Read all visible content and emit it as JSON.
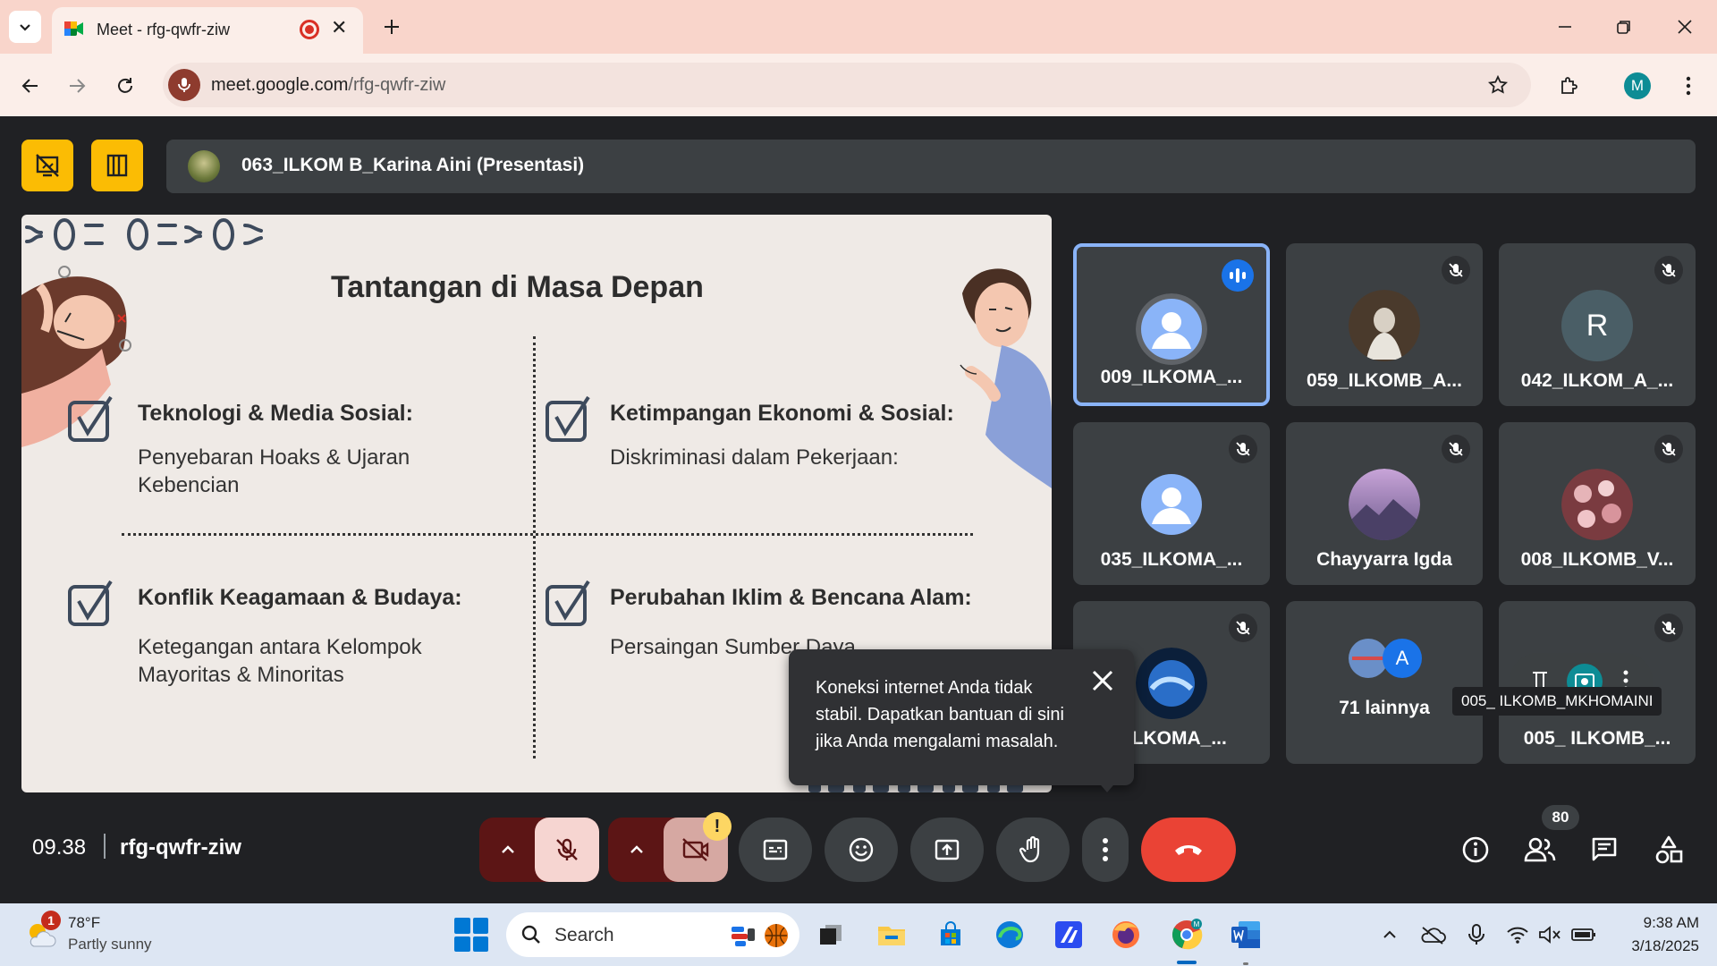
{
  "browser": {
    "tab_title": "Meet - rfg-qwfr-ziw",
    "new_tab_icon": "plus-icon",
    "url_host": "meet.google.com",
    "url_path": "/rfg-qwfr-ziw",
    "profile_initial": "M"
  },
  "meet": {
    "presenter_name": "063_ILKOM B_Karina Aini (Presentasi)",
    "slide": {
      "title": "Tantangan di Masa Depan",
      "quadrants": [
        {
          "title": "Teknologi & Media Sosial:",
          "body": "Penyebaran Hoaks & Ujaran Kebencian"
        },
        {
          "title": "Ketimpangan Ekonomi & Sosial:",
          "body": "Diskriminasi dalam Pekerjaan:"
        },
        {
          "title": "Konflik Keagamaan & Budaya:",
          "body": "Ketegangan antara Kelompok Mayoritas & Minoritas"
        },
        {
          "title": "Perubahan Iklim & Bencana Alam:",
          "body": "Persaingan Sumber Daya"
        }
      ]
    },
    "participants": [
      {
        "name": "009_ILKOMA_...",
        "avatar": "default-person",
        "state": "speaking"
      },
      {
        "name": "059_ILKOMB_A...",
        "avatar": "photo",
        "state": "muted"
      },
      {
        "name": "042_ILKOM_A_...",
        "avatar_letter": "R",
        "state": "muted"
      },
      {
        "name": "035_ILKOMA_...",
        "avatar": "default-person",
        "state": "muted"
      },
      {
        "name": "Chayyarra Igda",
        "avatar": "photo",
        "state": "muted"
      },
      {
        "name": "008_ILKOMB_V...",
        "avatar": "photo",
        "state": "muted"
      },
      {
        "name": "_ILKOMA_...",
        "avatar": "photo",
        "state": "muted"
      },
      {
        "name": "71 lainnya",
        "avatar_letter": "A",
        "state": "group"
      },
      {
        "name": "005_ ILKOMB_...",
        "avatar": "photo",
        "state": "muted"
      }
    ],
    "hover_tooltip": "005_ ILKOMB_MKHOMAINI",
    "toast": {
      "text": "Koneksi internet Anda tidak stabil. Dapatkan bantuan di sini jika Anda mengalami masalah."
    },
    "bottom": {
      "time": "09.38",
      "meeting_code": "rfg-qwfr-ziw",
      "camera_warning": "!",
      "people_count": "80"
    },
    "colors": {
      "leave": "#ea4335",
      "accent": "#8ab4f8",
      "presenter_buttons": "#fbbc04"
    }
  },
  "taskbar": {
    "weather_badge": "1",
    "weather_temp": "78°F",
    "weather_desc": "Partly sunny",
    "search_label": "Search",
    "clock_time": "9:38 AM",
    "clock_date": "3/18/2025"
  }
}
